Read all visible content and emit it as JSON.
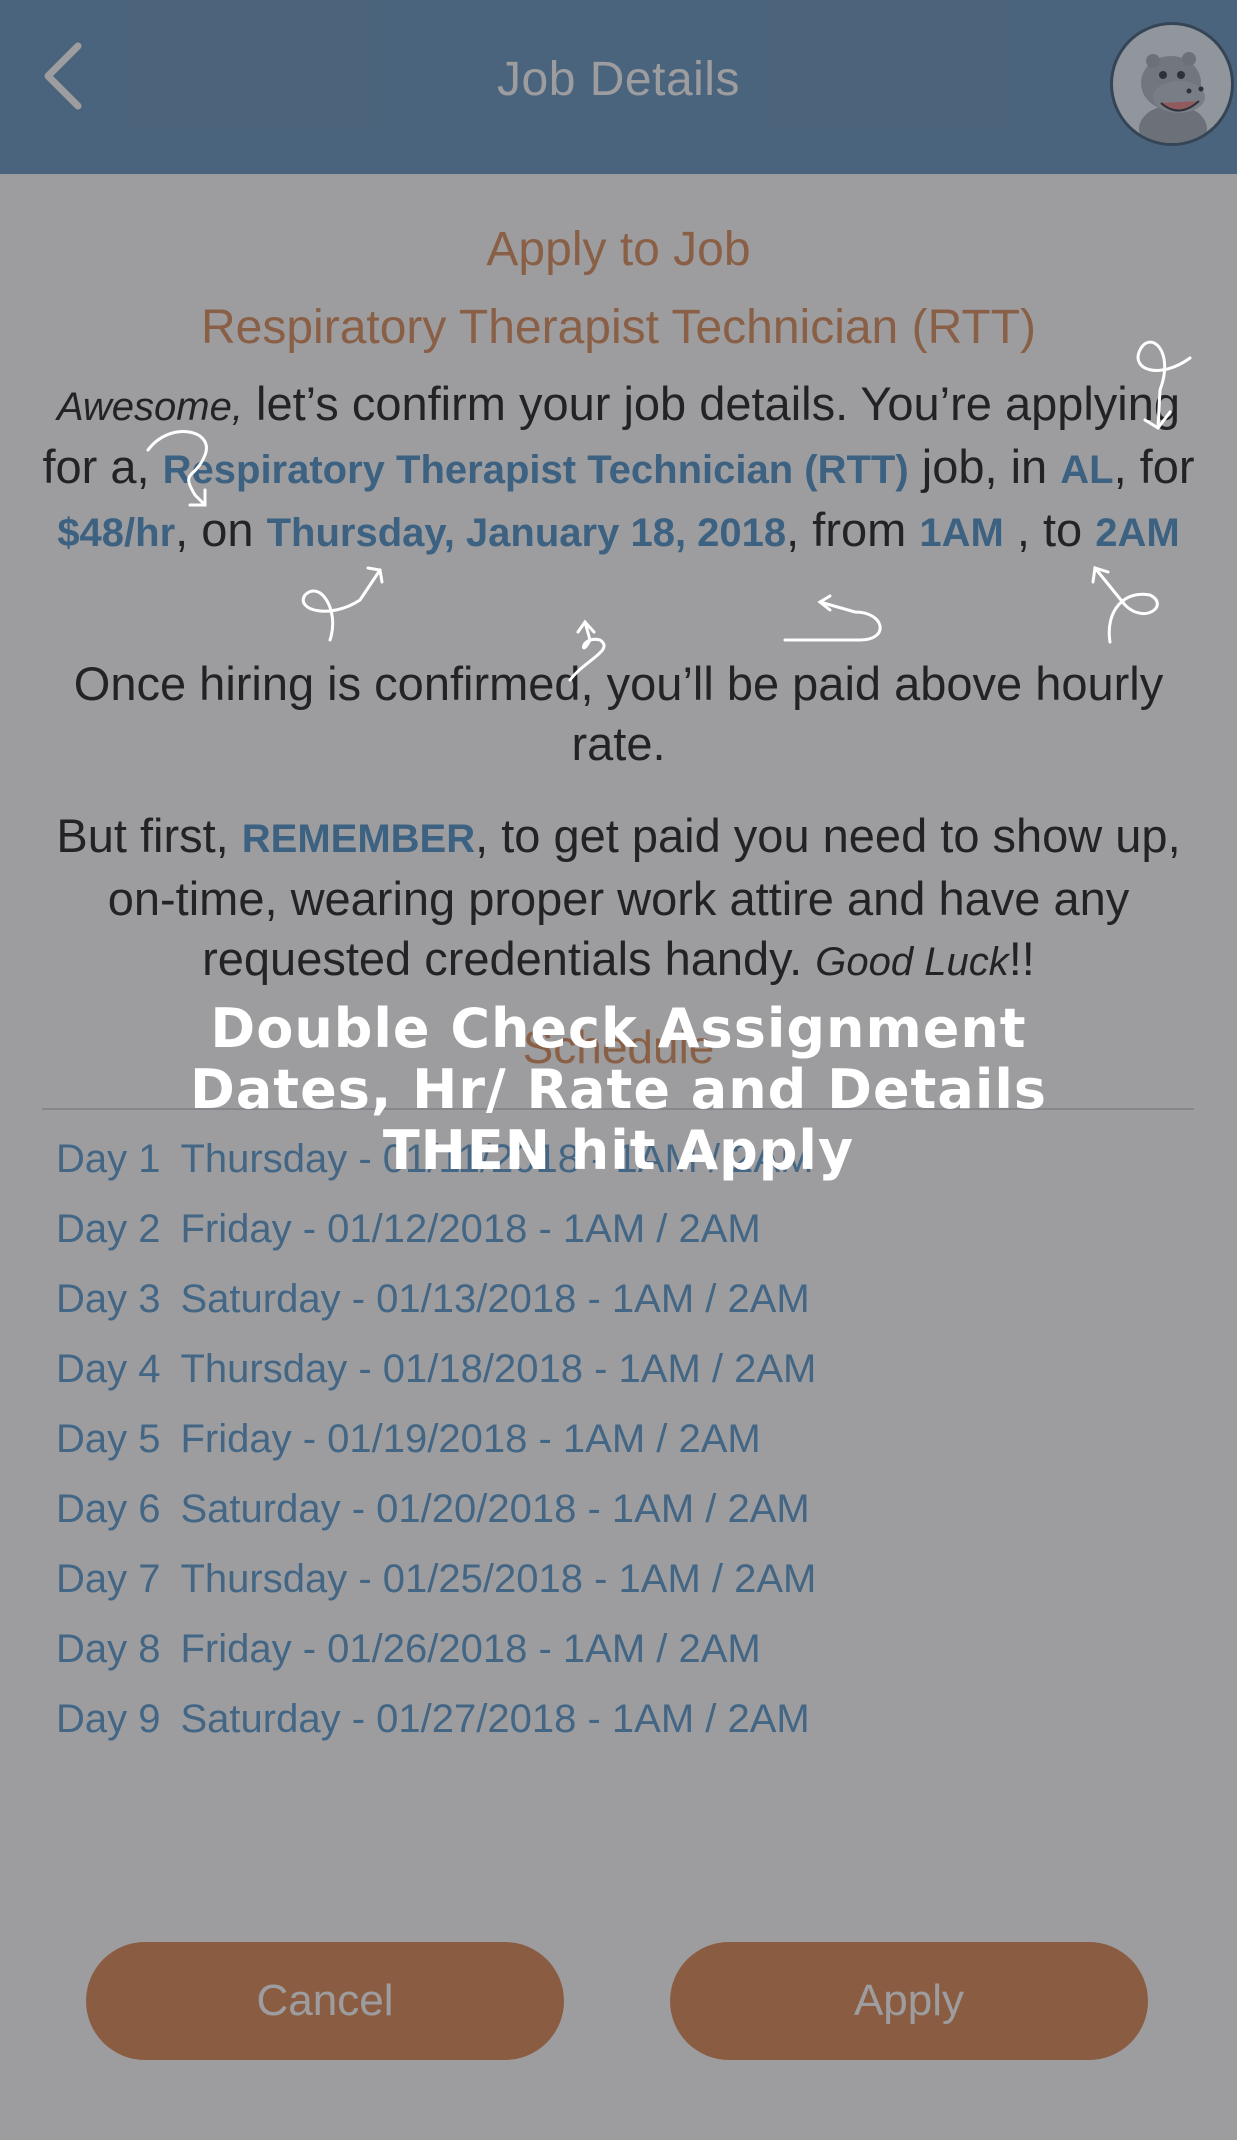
{
  "nav": {
    "title": "Job Details",
    "back_icon": "chevron-left-icon",
    "avatar_icon": "hippo-mascot-icon"
  },
  "apply_heading": "Apply to Job",
  "job_title": "Respiratory Therapist Technician (RTT)",
  "confirm": {
    "awesome": "Awesome,",
    "t1": " let’s confirm your job details. You’re applying for a, ",
    "job": "Respiratory Therapist Technician (RTT)",
    "t2": " job, in ",
    "state": "AL",
    "t3": ", for ",
    "rate": "$48/hr",
    "t4": ", on ",
    "date": "Thursday, January 18, 2018",
    "t5": ", from ",
    "start": "1AM",
    "t6": " , to ",
    "end": "2AM"
  },
  "hiring_note": "Once hiring is confirmed, you’ll be paid above hourly rate.",
  "reminder": {
    "t1": "But first, ",
    "keyword": "REMEMBER",
    "t2": ", to get paid you need to show up, on-time, wearing proper work attire and have any requested credentials handy. ",
    "good_luck": "Good Luck",
    "t3": "!!"
  },
  "schedule": {
    "title": "Schedule",
    "rows": [
      {
        "day": "Day 1",
        "detail": "Thursday - 01/11/2018 - 1AM  / 2AM"
      },
      {
        "day": "Day 2",
        "detail": "Friday - 01/12/2018 - 1AM  / 2AM"
      },
      {
        "day": "Day 3",
        "detail": "Saturday - 01/13/2018 - 1AM  / 2AM"
      },
      {
        "day": "Day 4",
        "detail": "Thursday - 01/18/2018 - 1AM  / 2AM"
      },
      {
        "day": "Day 5",
        "detail": "Friday - 01/19/2018 - 1AM  / 2AM"
      },
      {
        "day": "Day 6",
        "detail": "Saturday - 01/20/2018 - 1AM  / 2AM"
      },
      {
        "day": "Day 7",
        "detail": "Thursday - 01/25/2018 - 1AM  / 2AM"
      },
      {
        "day": "Day 8",
        "detail": "Friday - 01/26/2018 - 1AM  / 2AM"
      },
      {
        "day": "Day 9",
        "detail": "Saturday - 01/27/2018 - 1AM  / 2AM"
      }
    ]
  },
  "buttons": {
    "cancel": "Cancel",
    "apply": "Apply"
  },
  "coach": {
    "line1": "Double Check Assignment",
    "line2": "Dates, Hr/ Rate and Details",
    "line3": "THEN hit Apply"
  },
  "colors": {
    "nav_bg": "#5b8db8",
    "accent_orange": "#d7824a",
    "highlight_blue": "#3d86c0",
    "button_bg": "#d97f43",
    "overlay": "rgba(60,60,65,0.5)"
  }
}
